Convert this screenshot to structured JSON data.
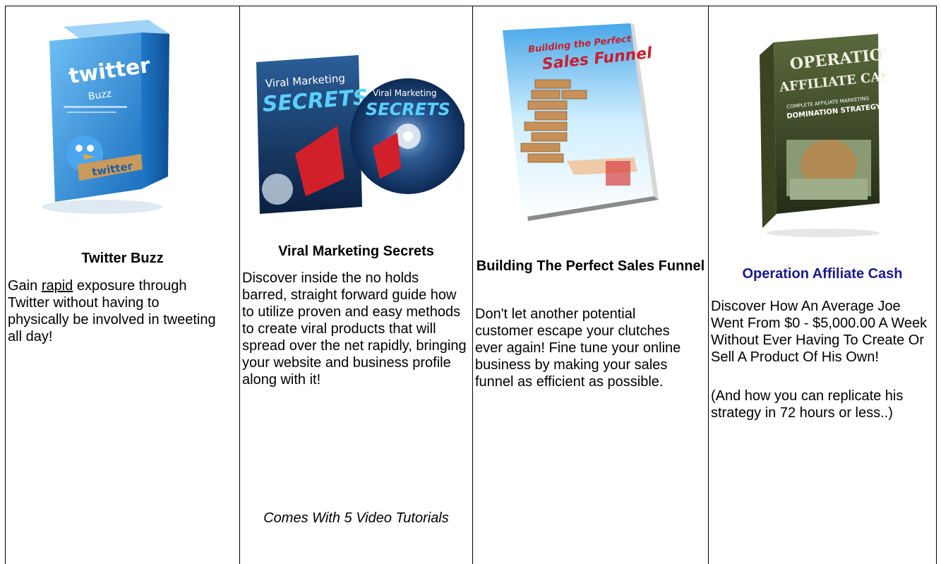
{
  "products": [
    {
      "title": "Twitter Buzz",
      "image_text": {
        "brand": "twitter",
        "sub": "Buzz",
        "badge": "twitter"
      },
      "desc_pre": "Gain ",
      "desc_underline": "rapid",
      "desc_post": " exposure through Twitter without having to physically be involved in tweeting all day!"
    },
    {
      "title": "Viral Marketing Secrets",
      "image_text": {
        "line1": "Viral Marketing",
        "line2": "SECRETS"
      },
      "desc": "Discover inside the no holds barred, straight forward guide how to utilize proven and easy methods to create viral products that will spread over the net rapidly, bringing your website and business profile along with it!",
      "note": "Comes With 5 Video Tutorials"
    },
    {
      "title": "Building The Perfect Sales Funnel",
      "image_text": {
        "line1": "Building the Perfect",
        "line2": "Sales Funnel"
      },
      "desc": "Don't let another potential customer escape your clutches ever again! Fine tune your online business by making your sales funnel as efficient as possible."
    },
    {
      "title": "Operation Affiliate Cash",
      "image_text": {
        "line1": "OPERATION",
        "line2": "AFFILIATE CASH",
        "line3": "COMPLETE AFFILIATE MARKETING",
        "line4": "DOMINATION STRATEGY"
      },
      "desc": "Discover How An Average Joe Went From $0 - $5,000.00 A Week Without Ever Having To Create Or Sell A Product Of His Own!",
      "desc2": "(And how you can replicate his strategy in 72 hours or less..)"
    }
  ],
  "colors": {
    "link": "#1a1a8c",
    "twitter_blue": "#2a8fd8",
    "viral_navy": "#0f2d5c",
    "book_green": "#3d4a2a"
  }
}
